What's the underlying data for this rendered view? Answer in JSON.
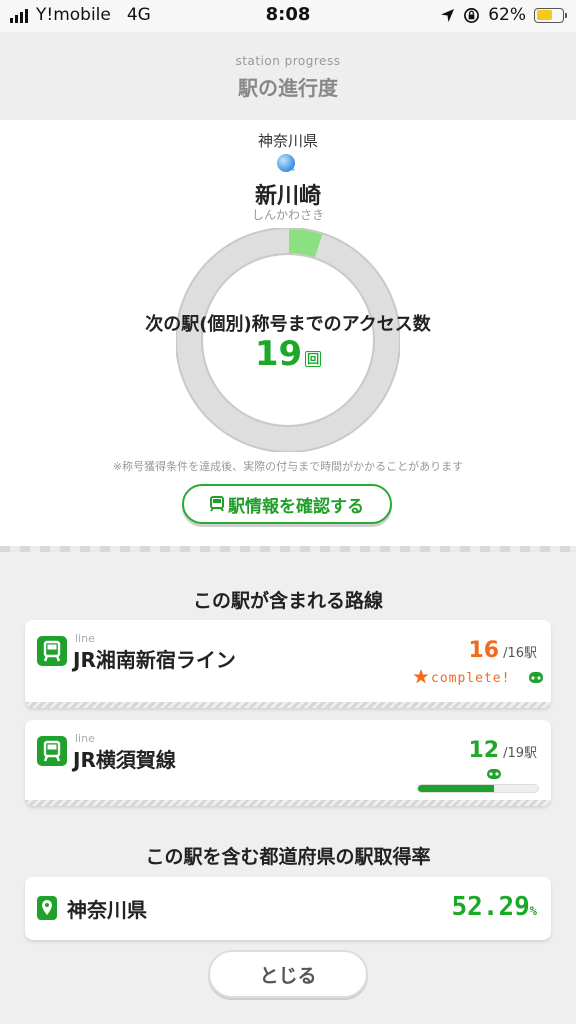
{
  "status_bar": {
    "carrier": "Y!mobile",
    "network": "4G",
    "time": "8:08",
    "battery": "62%",
    "battery_level": 0.62
  },
  "header": {
    "subtitle": "station progress",
    "title": "駅の進行度"
  },
  "station": {
    "prefecture": "神奈川県",
    "name": "新川崎",
    "kana": "しんかわさき",
    "progress_fraction": 0.05,
    "access_label": "次の駅(個別)称号までのアクセス数",
    "access_count": "19",
    "access_unit": "回",
    "note": "※称号獲得条件を達成後、実際の付与まで時間がかかることがあります",
    "info_button": "駅情報を確認する"
  },
  "lines_section": {
    "title": "この駅が含まれる路線",
    "lines": [
      {
        "tag": "line",
        "name": "JR湘南新宿ライン",
        "count": "16",
        "total": "/16駅",
        "count_color": "#f26a1b",
        "complete_text": "complete!",
        "progress": 1.0
      },
      {
        "tag": "line",
        "name": "JR横須賀線",
        "count": "12",
        "total": "/19駅",
        "count_color": "#1ea82a",
        "progress": 0.63
      }
    ]
  },
  "prefecture_section": {
    "title": "この駅を含む都道府県の駅取得率",
    "name": "神奈川県",
    "rate": "52.29",
    "unit": "%"
  },
  "close_button": "とじる",
  "colors": {
    "accent_green": "#1ea82a",
    "complete_orange": "#f26a1b",
    "ring_gray": "#dddddd",
    "ring_progress": "#8be07f"
  }
}
